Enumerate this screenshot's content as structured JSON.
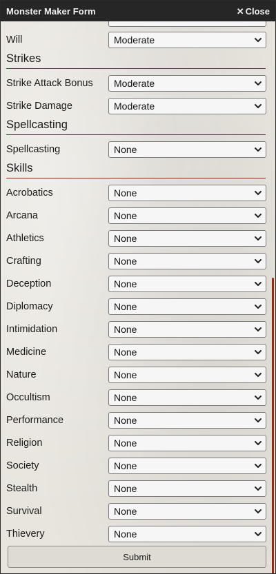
{
  "window": {
    "title": "Monster Maker Form",
    "close_label": "Close",
    "close_icon": "close-icon"
  },
  "rows": {
    "will": {
      "label": "Will",
      "value": "Moderate"
    },
    "strike_attack_bonus": {
      "label": "Strike Attack Bonus",
      "value": "Moderate"
    },
    "strike_damage": {
      "label": "Strike Damage",
      "value": "Moderate"
    },
    "spellcasting": {
      "label": "Spellcasting",
      "value": "None"
    }
  },
  "sections": {
    "strikes": "Strikes",
    "spellcasting": "Spellcasting",
    "skills": "Skills"
  },
  "skills": [
    {
      "label": "Acrobatics",
      "value": "None"
    },
    {
      "label": "Arcana",
      "value": "None"
    },
    {
      "label": "Athletics",
      "value": "None"
    },
    {
      "label": "Crafting",
      "value": "None"
    },
    {
      "label": "Deception",
      "value": "None"
    },
    {
      "label": "Diplomacy",
      "value": "None"
    },
    {
      "label": "Intimidation",
      "value": "None"
    },
    {
      "label": "Medicine",
      "value": "None"
    },
    {
      "label": "Nature",
      "value": "None"
    },
    {
      "label": "Occultism",
      "value": "None"
    },
    {
      "label": "Performance",
      "value": "None"
    },
    {
      "label": "Religion",
      "value": "None"
    },
    {
      "label": "Society",
      "value": "None"
    },
    {
      "label": "Stealth",
      "value": "None"
    },
    {
      "label": "Survival",
      "value": "None"
    },
    {
      "label": "Thievery",
      "value": "None"
    }
  ],
  "submit_label": "Submit",
  "colors": {
    "titlebar": "#262626",
    "accent_rule": "#7f2a1a",
    "scrollbar": "#9b2a0c"
  }
}
